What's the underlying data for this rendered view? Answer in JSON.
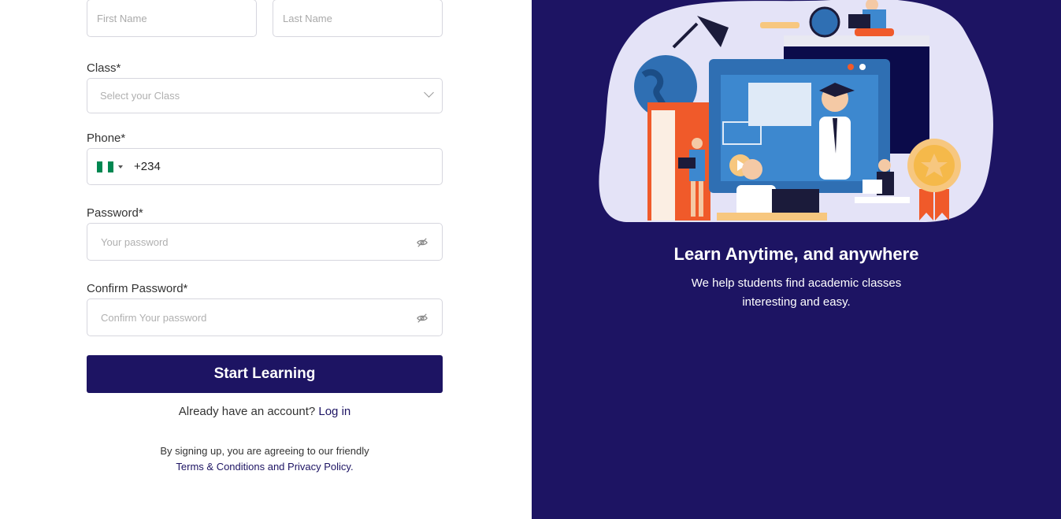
{
  "form": {
    "first_name_placeholder": "First Name",
    "last_name_placeholder": "Last Name",
    "class_label": "Class*",
    "class_placeholder": "Select your Class",
    "phone_label": "Phone*",
    "phone_dial_code": "+234",
    "password_label": "Password*",
    "password_placeholder": "Your password",
    "confirm_label": "Confirm Password*",
    "confirm_placeholder": "Confirm Your password",
    "submit_label": "Start Learning",
    "login_prompt": "Already have an account?",
    "login_link": "Log in",
    "terms_line1": "By signing up, you are agreeing to our friendly",
    "terms_link": "Terms & Conditions and Privacy Policy."
  },
  "promo": {
    "heading": "Learn Anytime, and anywhere",
    "sub_line1": "We help students find academic classes",
    "sub_line2": "interesting and easy."
  },
  "colors": {
    "brand": "#1d1463",
    "flag_green": "#008751",
    "flag_white": "#ffffff"
  },
  "icons": {
    "select": "chevron-down-icon",
    "password": "eye-slash-icon",
    "flag": "nigeria-flag-icon"
  }
}
